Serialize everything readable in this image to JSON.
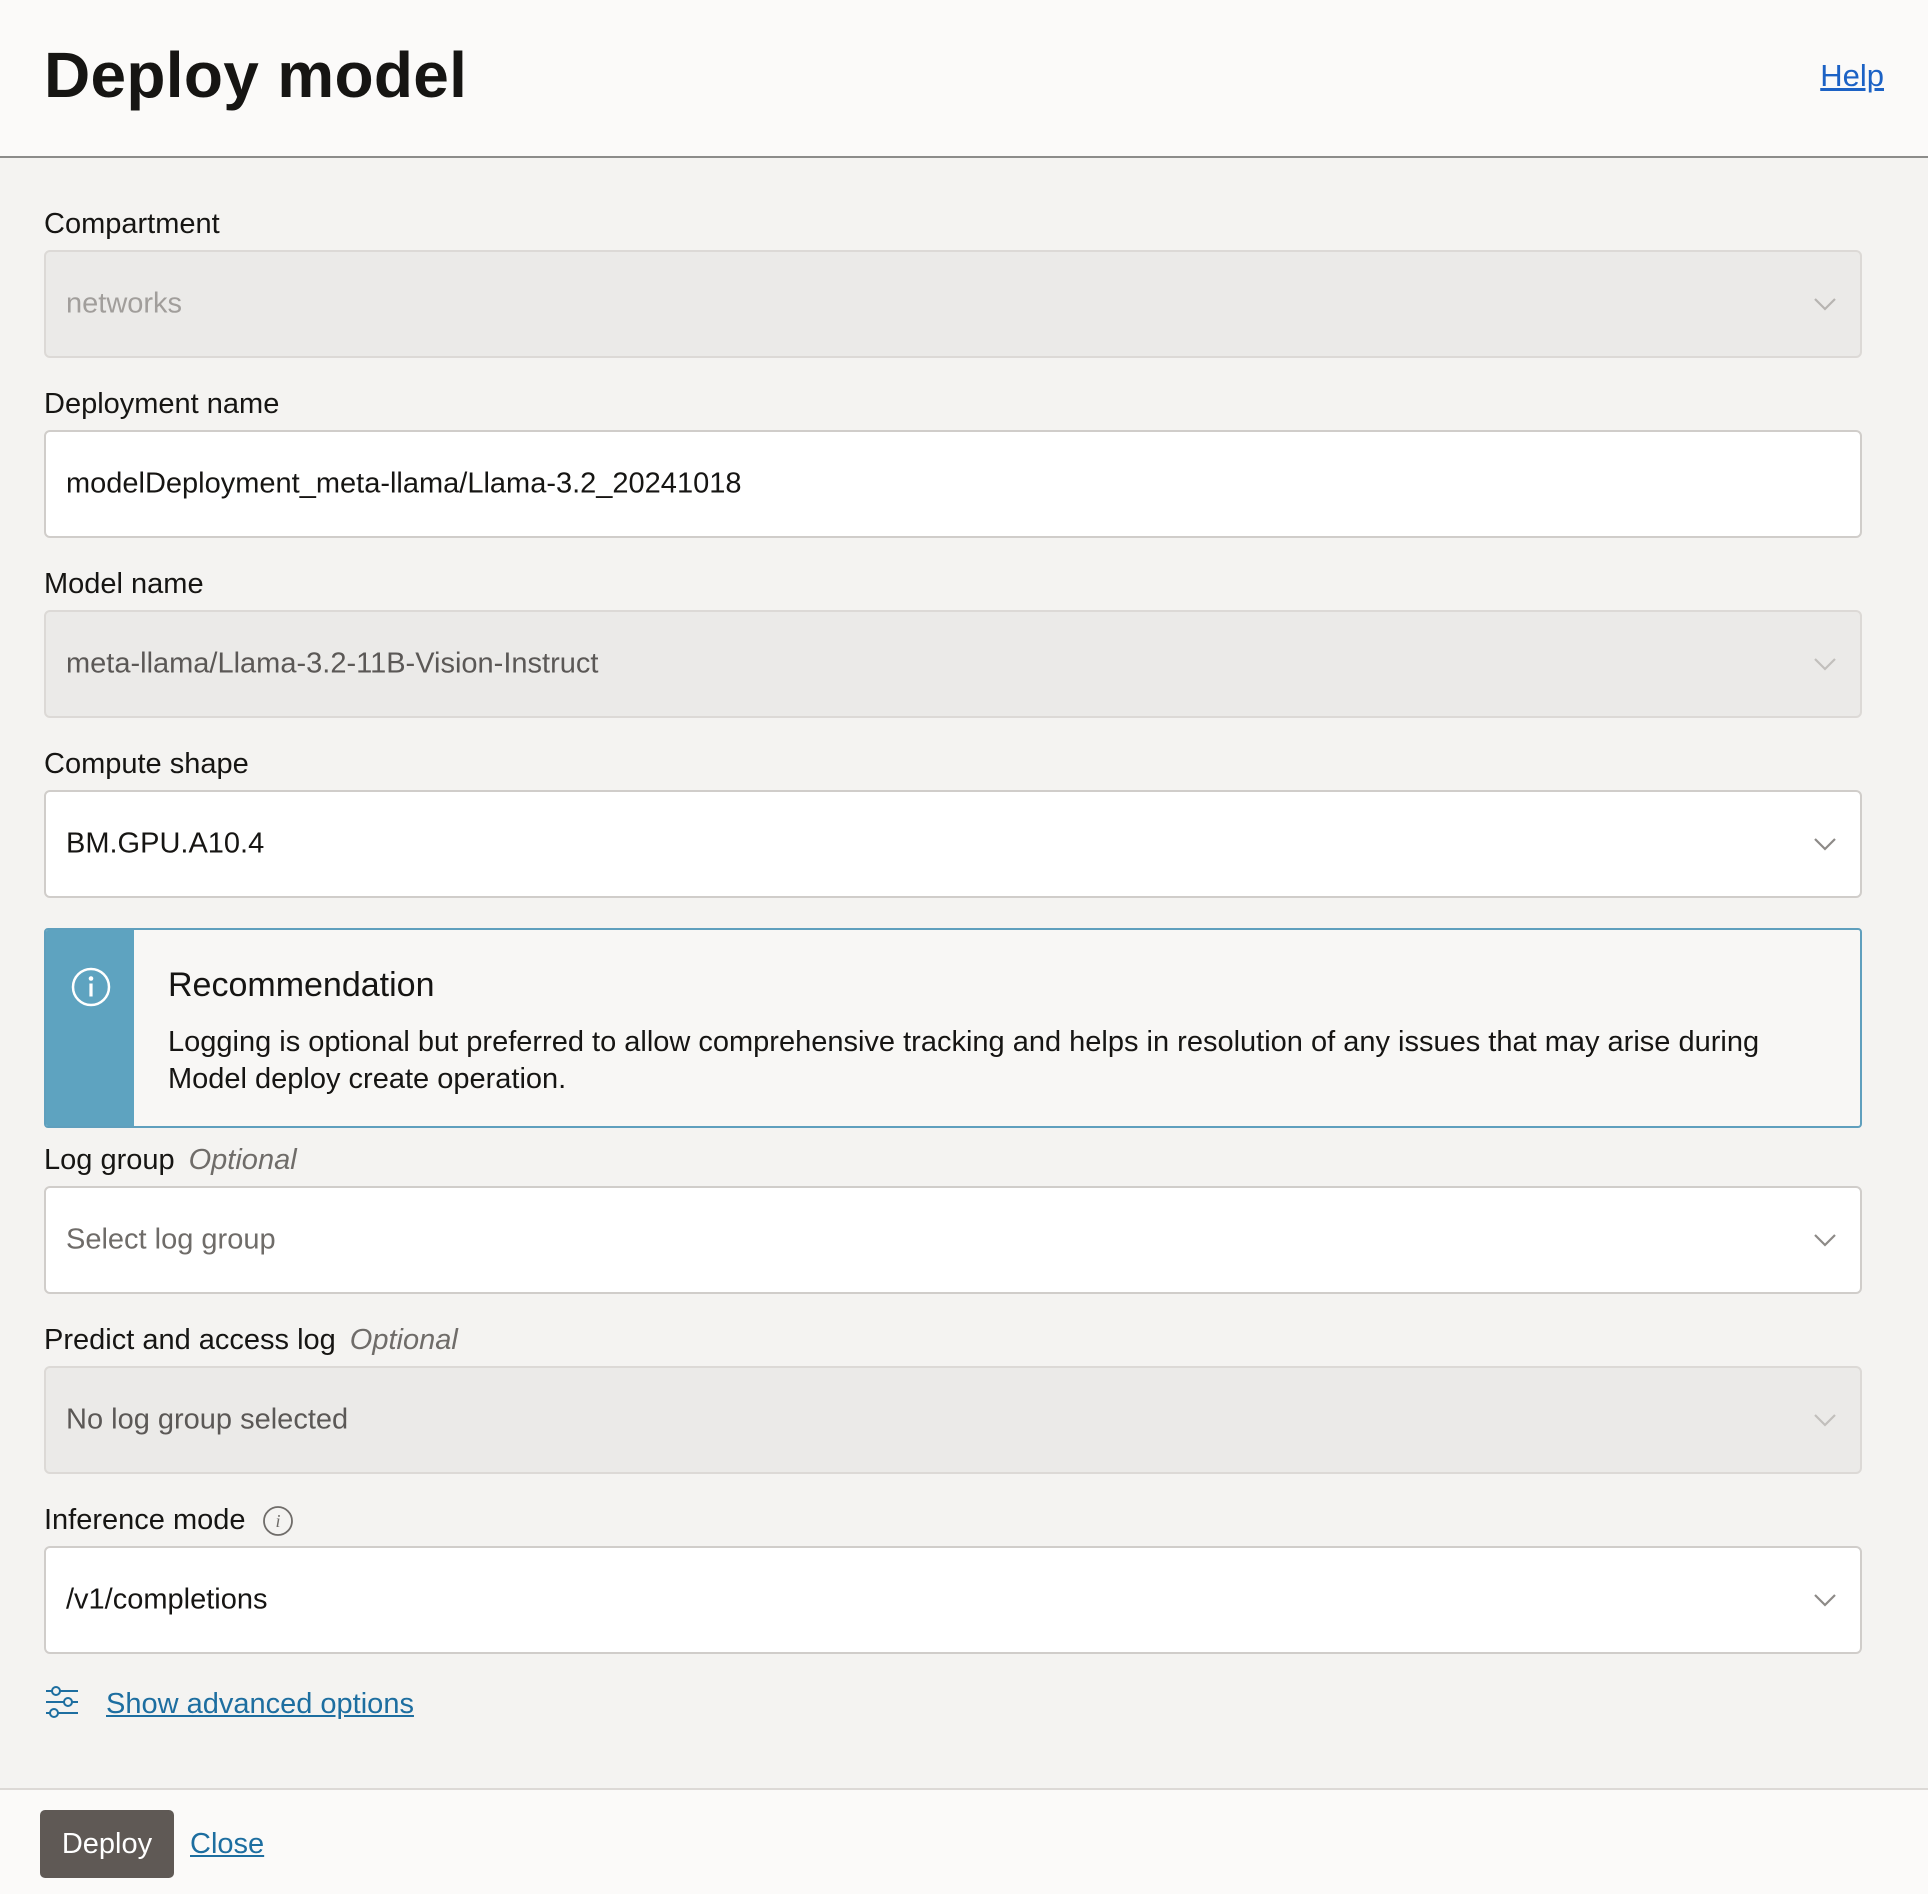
{
  "header": {
    "title": "Deploy model",
    "help_label": "Help"
  },
  "fields": {
    "compartment": {
      "label": "Compartment",
      "value": "networks",
      "disabled": true
    },
    "deployment_name": {
      "label": "Deployment name",
      "value": "modelDeployment_meta-llama/Llama-3.2_20241018"
    },
    "model_name": {
      "label": "Model name",
      "value": "meta-llama/Llama-3.2-11B-Vision-Instruct",
      "disabled": true
    },
    "compute_shape": {
      "label": "Compute shape",
      "value": "BM.GPU.A10.4"
    },
    "log_group": {
      "label": "Log group",
      "optional": "Optional",
      "placeholder": "Select log group"
    },
    "predict_log": {
      "label": "Predict and access log",
      "optional": "Optional",
      "value": "No log group selected",
      "disabled": true
    },
    "inference_mode": {
      "label": "Inference mode",
      "value": "/v1/completions"
    }
  },
  "recommendation": {
    "title": "Recommendation",
    "text": "Logging is optional but preferred to allow comprehensive tracking and helps in resolution of any issues that may arise during Model deploy create operation."
  },
  "advanced": {
    "label": "Show advanced options"
  },
  "footer": {
    "deploy_label": "Deploy",
    "close_label": "Close"
  },
  "colors": {
    "info_strip": "#5ea3c0",
    "primary_button": "#5f5955",
    "link": "#1d6ea0",
    "help_link": "#1c62c5"
  },
  "icons": [
    "info-icon",
    "chevron-down-icon",
    "sliders-icon"
  ]
}
